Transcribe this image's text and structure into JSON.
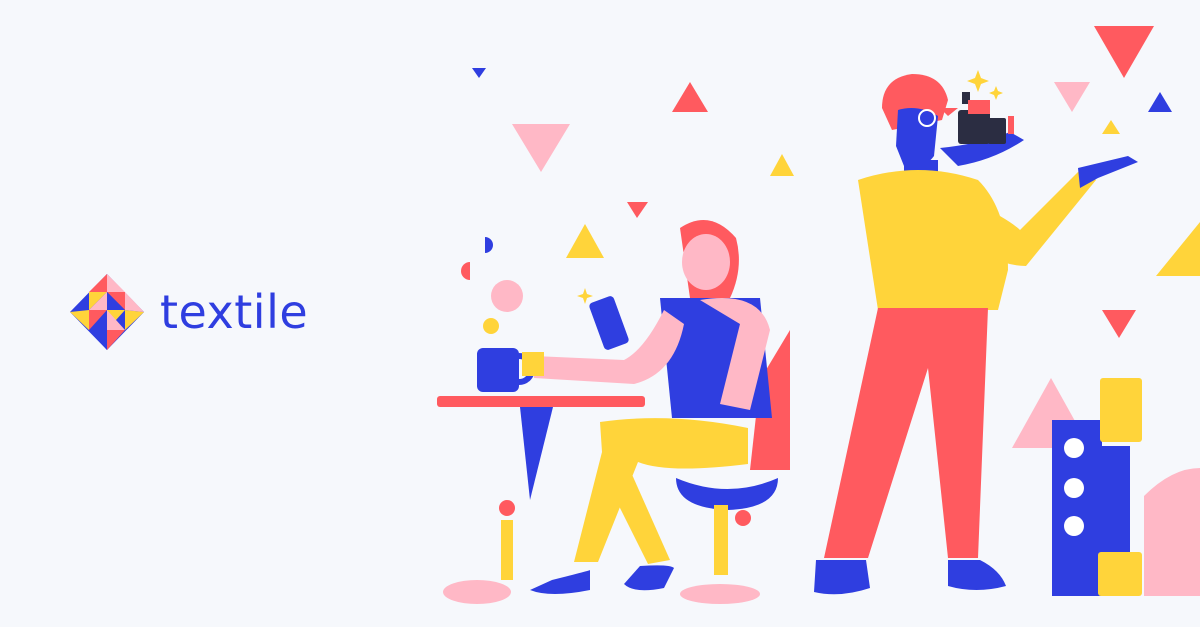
{
  "brand": {
    "name": "textile",
    "icon": "textile-logo-icon"
  },
  "colors": {
    "background": "#f6f8fc",
    "blue": "#2f3ee0",
    "red": "#ff5a5f",
    "yellow": "#ffd43a",
    "pink": "#ffb8c6",
    "dark": "#2b2d42"
  },
  "illustration": {
    "description_icons": [
      "seated-woman-with-phone",
      "standing-man-with-camera",
      "cafe-table",
      "coffee-mug",
      "office-chair",
      "geometric-tower",
      "floating-triangles"
    ]
  }
}
